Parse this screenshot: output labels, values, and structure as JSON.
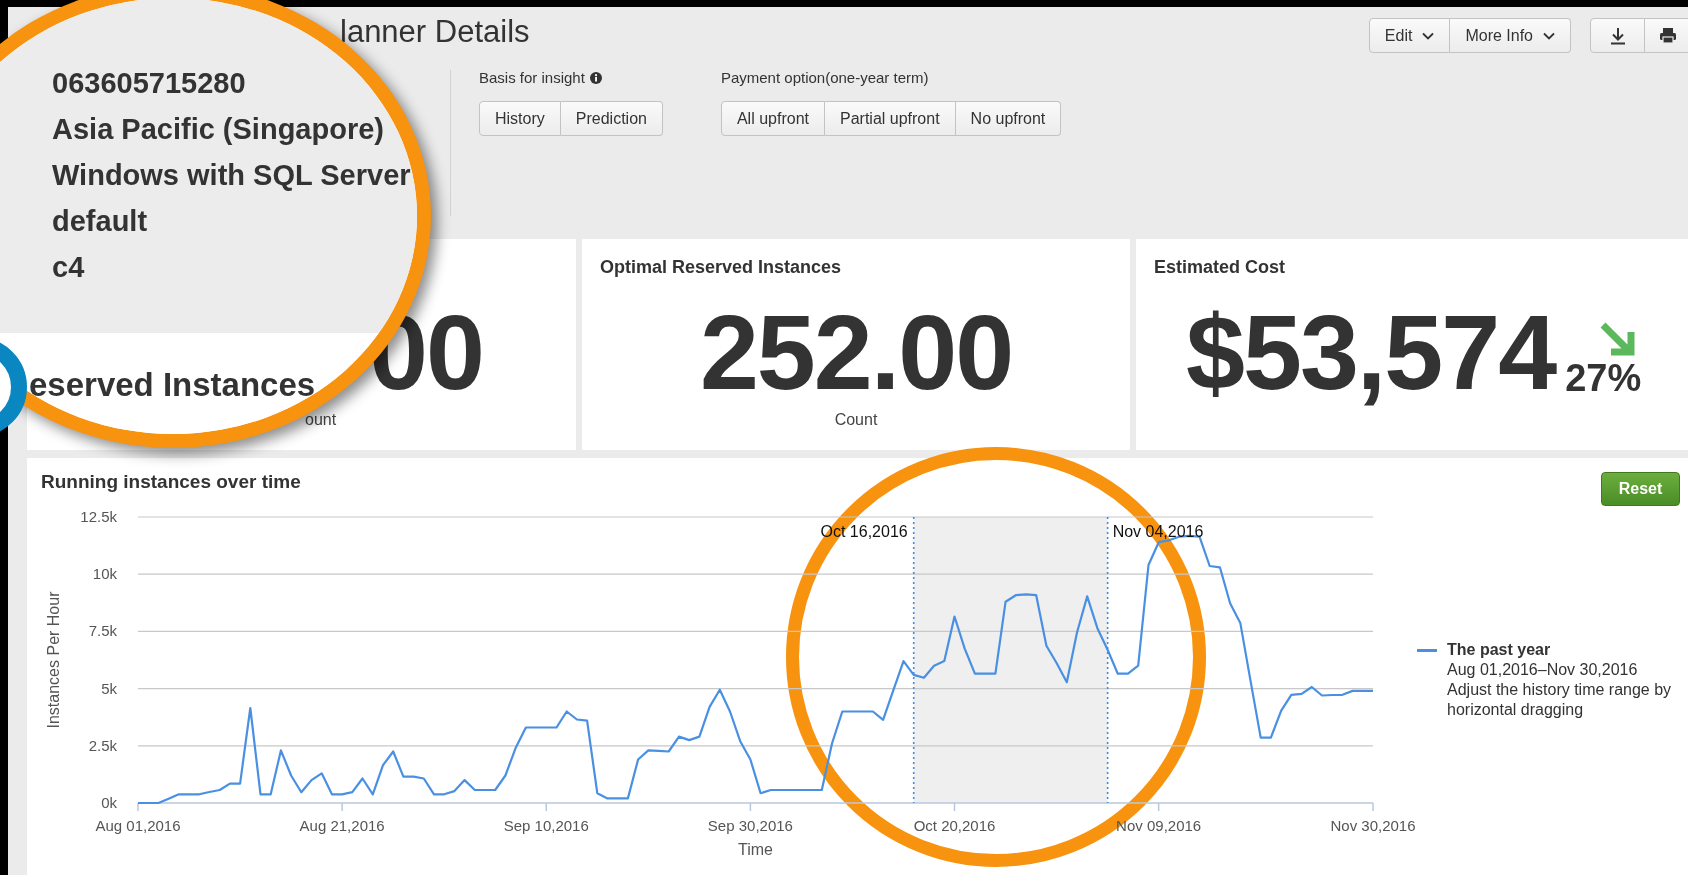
{
  "header": {
    "title": "lanner Details",
    "actions": [
      {
        "label": "Edit",
        "kind": "dropdown"
      },
      {
        "label": "More Info",
        "kind": "dropdown"
      }
    ]
  },
  "basis": {
    "label": "Basis for insight",
    "options": [
      "History",
      "Prediction"
    ]
  },
  "payment": {
    "label": "Payment option(one-year term)",
    "options": [
      "All upfront",
      "Partial upfront",
      "No upfront"
    ]
  },
  "magnifier": {
    "lines": [
      "063605715280",
      "Asia Pacific (Singapore)",
      "Windows with SQL Server",
      "default",
      "c4"
    ],
    "caption": "eserved Instances"
  },
  "cards": [
    {
      "kind": "partial",
      "value": "00",
      "unit": "ount"
    },
    {
      "kind": "count",
      "title": "Optimal Reserved Instances",
      "value": "252.00",
      "unit": "Count"
    },
    {
      "kind": "cost",
      "title": "Estimated Cost",
      "value": "$53,574",
      "change": "27%"
    }
  ],
  "chart": {
    "reset": "Reset",
    "legend_lines": [
      "Aug 01,2016–Nov 30,2016",
      "Adjust the history time range by horizontal dragging"
    ],
    "chart_data": {
      "type": "line",
      "title": "Running instances over time",
      "xlabel": "Time",
      "ylabel": "Instances Per Hour",
      "categories": [
        "Aug 01,2016",
        null,
        null,
        null,
        null,
        null,
        null,
        null,
        null,
        null,
        null,
        null,
        null,
        null,
        null,
        null,
        null,
        null,
        null,
        null,
        "Aug 21,2016",
        null,
        null,
        null,
        null,
        null,
        null,
        null,
        null,
        null,
        null,
        null,
        null,
        null,
        null,
        null,
        null,
        null,
        null,
        null,
        "Sep 10,2016",
        null,
        null,
        null,
        null,
        null,
        null,
        null,
        null,
        null,
        null,
        null,
        null,
        null,
        null,
        null,
        null,
        null,
        null,
        null,
        "Sep 30,2016",
        null,
        null,
        null,
        null,
        null,
        null,
        null,
        null,
        null,
        null,
        null,
        null,
        null,
        null,
        null,
        null,
        null,
        null,
        null,
        "Oct 20,2016",
        null,
        null,
        null,
        null,
        null,
        null,
        null,
        null,
        null,
        null,
        null,
        null,
        null,
        null,
        null,
        null,
        null,
        null,
        null,
        "Nov 09,2016",
        null,
        null,
        null,
        null,
        null,
        null,
        null,
        null,
        null,
        null,
        null,
        null,
        null,
        null,
        null,
        null,
        null,
        null,
        null,
        null,
        "Nov 30,2016"
      ],
      "series": [
        {
          "name": "The past year",
          "color": "#4a90e2",
          "values": [
            0,
            0,
            0,
            190,
            380,
            380,
            380,
            480,
            570,
            850,
            850,
            4150,
            380,
            380,
            2300,
            1200,
            470,
            1000,
            1300,
            380,
            380,
            470,
            1070,
            380,
            1650,
            2250,
            1150,
            1150,
            1070,
            380,
            380,
            520,
            1000,
            570,
            570,
            570,
            1200,
            2400,
            3300,
            3300,
            3300,
            3300,
            4000,
            3650,
            3600,
            430,
            200,
            200,
            200,
            1900,
            2300,
            2280,
            2250,
            2900,
            2750,
            2900,
            4200,
            4950,
            4000,
            2700,
            1900,
            430,
            570,
            570,
            570,
            570,
            570,
            570,
            2600,
            4000,
            4000,
            4000,
            4000,
            3630,
            4920,
            6200,
            5600,
            5470,
            6000,
            6200,
            8150,
            6750,
            5650,
            5650,
            5650,
            8800,
            9080,
            9120,
            9080,
            6870,
            6120,
            5280,
            7450,
            9030,
            7640,
            6700,
            5650,
            5650,
            6000,
            10400,
            11400,
            11480,
            11640,
            11680,
            11640,
            10360,
            10300,
            8730,
            7870,
            5350,
            2860,
            2860,
            4030,
            4730,
            4770,
            5070,
            4700,
            4720,
            4730,
            4900,
            4900,
            4900
          ]
        }
      ],
      "ylim": [
        0,
        12500
      ],
      "yticks": [
        {
          "value": 0,
          "label": "0k"
        },
        {
          "value": 2500,
          "label": "2.5k"
        },
        {
          "value": 5000,
          "label": "5k"
        },
        {
          "value": 7500,
          "label": "7.5k"
        },
        {
          "value": 10000,
          "label": "10k"
        },
        {
          "value": 12500,
          "label": "12.5k"
        }
      ],
      "grid": true,
      "annotations": [
        "Oct 16,2016",
        "Nov 04,2016"
      ]
    }
  }
}
